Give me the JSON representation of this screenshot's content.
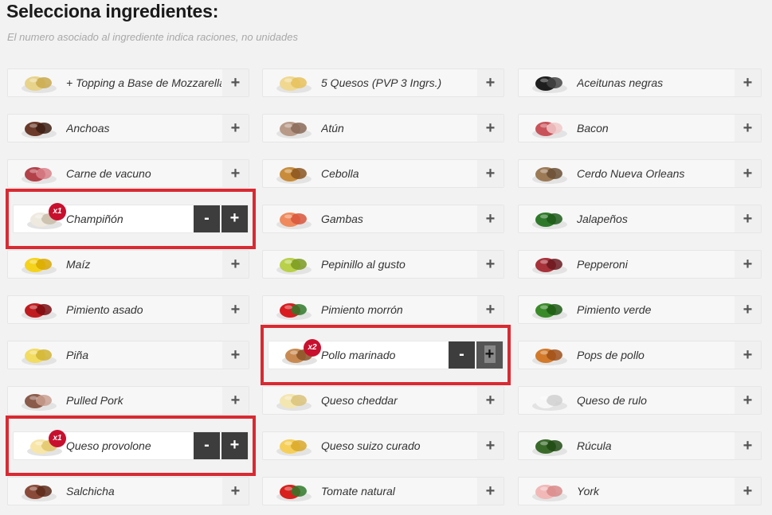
{
  "header": {
    "title": "Selecciona ingredientes:",
    "subtitle": "El numero asociado al ingrediente indica raciones, no unidades"
  },
  "buttons": {
    "plus": "+",
    "minus": "-"
  },
  "ingredients": [
    {
      "name": "+ Topping a Base de Mozzarella",
      "icon": "mozzarella-icon",
      "color": "#e8d38a",
      "color2": "#c9a94e"
    },
    {
      "name": "5 Quesos (PVP 3 Ingrs.)",
      "icon": "five-cheeses-icon",
      "color": "#f0d890",
      "color2": "#e6c15a"
    },
    {
      "name": "Aceitunas negras",
      "icon": "black-olives-icon",
      "color": "#1e1e1e",
      "color2": "#444"
    },
    {
      "name": "Anchoas",
      "icon": "anchovies-icon",
      "color": "#6b3a2a",
      "color2": "#3d1f14"
    },
    {
      "name": "Atún",
      "icon": "tuna-icon",
      "color": "#b89a88",
      "color2": "#8a6a58"
    },
    {
      "name": "Bacon",
      "icon": "bacon-icon",
      "color": "#c9535a",
      "color2": "#f1c9c9"
    },
    {
      "name": "Carne de vacuno",
      "icon": "beef-icon",
      "color": "#b3414a",
      "color2": "#d98088"
    },
    {
      "name": "Cebolla",
      "icon": "onion-icon",
      "color": "#c98c3a",
      "color2": "#8a5520"
    },
    {
      "name": "Cerdo Nueva Orleans",
      "icon": "pork-icon",
      "color": "#9c7a56",
      "color2": "#6a4f35"
    },
    {
      "name": "Champiñón",
      "icon": "mushroom-icon",
      "color": "#efeae0",
      "color2": "#c8bca8",
      "selected": true,
      "count": "x1"
    },
    {
      "name": "Gambas",
      "icon": "shrimp-icon",
      "color": "#f08a5c",
      "color2": "#d8553a"
    },
    {
      "name": "Jalapeños",
      "icon": "jalapeno-icon",
      "color": "#2f7a2a",
      "color2": "#1d5a1a"
    },
    {
      "name": "Maíz",
      "icon": "corn-icon",
      "color": "#f5d31c",
      "color2": "#d9a800"
    },
    {
      "name": "Pepinillo al gusto",
      "icon": "pickle-icon",
      "color": "#b8d04a",
      "color2": "#7a9a20"
    },
    {
      "name": "Pepperoni",
      "icon": "pepperoni-icon",
      "color": "#a8323a",
      "color2": "#6a1a20"
    },
    {
      "name": "Pimiento asado",
      "icon": "roasted-pepper-icon",
      "color": "#c01c20",
      "color2": "#7a0c10"
    },
    {
      "name": "Pimiento morrón",
      "icon": "red-pepper-icon",
      "color": "#d81c20",
      "color2": "#2f7a2a"
    },
    {
      "name": "Pimiento verde",
      "icon": "green-pepper-icon",
      "color": "#3a8a2a",
      "color2": "#1d5a14"
    },
    {
      "name": "Piña",
      "icon": "pineapple-icon",
      "color": "#f2dc62",
      "color2": "#d1b433"
    },
    {
      "name": "Pollo marinado",
      "icon": "chicken-icon",
      "color": "#c98a52",
      "color2": "#8a5228",
      "selected": true,
      "count": "x2",
      "hover": true
    },
    {
      "name": "Pops de pollo",
      "icon": "chicken-pops-icon",
      "color": "#d27a2a",
      "color2": "#a0501a"
    },
    {
      "name": "Pulled Pork",
      "icon": "pulled-pork-icon",
      "color": "#8a5a4a",
      "color2": "#c9a090"
    },
    {
      "name": "Queso cheddar",
      "icon": "cheddar-icon",
      "color": "#f3e6b0",
      "color2": "#d9c27a"
    },
    {
      "name": "Queso de rulo",
      "icon": "goat-cheese-icon",
      "color": "#f7f7f7",
      "color2": "#d0d0d0"
    },
    {
      "name": "Queso provolone",
      "icon": "provolone-icon",
      "color": "#f7e6a8",
      "color2": "#e2c66a",
      "selected": true,
      "count": "x1"
    },
    {
      "name": "Queso suizo curado",
      "icon": "swiss-cheese-icon",
      "color": "#f5cf5a",
      "color2": "#d9a82a"
    },
    {
      "name": "Rúcula",
      "icon": "arugula-icon",
      "color": "#3a6a2a",
      "color2": "#204a14"
    },
    {
      "name": "Salchicha",
      "icon": "sausage-icon",
      "color": "#8a4a3a",
      "color2": "#5a2a1a"
    },
    {
      "name": "Tomate natural",
      "icon": "tomato-icon",
      "color": "#d8201c",
      "color2": "#2f7a2a"
    },
    {
      "name": "York",
      "icon": "ham-icon",
      "color": "#f2b8b8",
      "color2": "#d98a8a"
    }
  ]
}
